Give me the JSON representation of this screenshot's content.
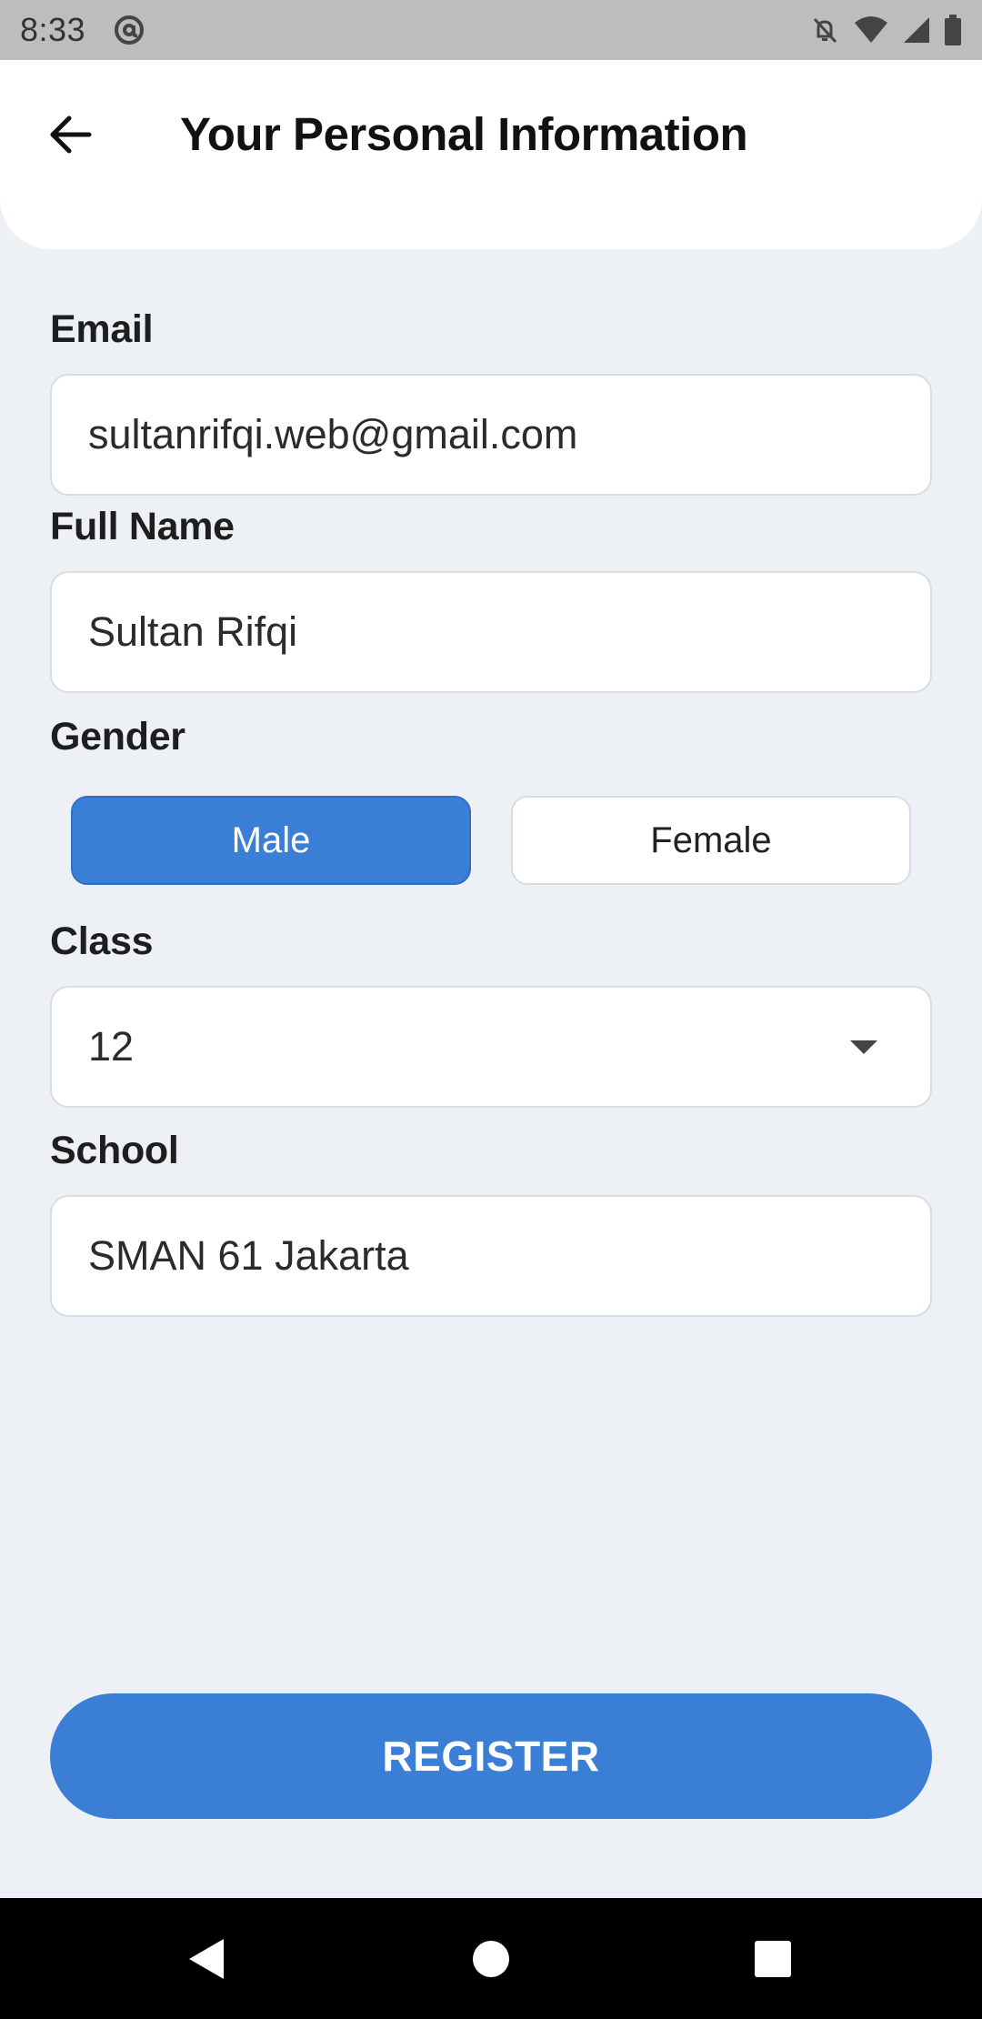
{
  "status_bar": {
    "time": "8:33",
    "icons": [
      "at-sign-icon",
      "notifications-off-icon",
      "wifi-icon",
      "signal-icon",
      "battery-icon"
    ]
  },
  "header": {
    "title": "Your Personal Information",
    "back_icon": "arrow-left-icon"
  },
  "form": {
    "email": {
      "label": "Email",
      "value": "sultanrifqi.web@gmail.com"
    },
    "full_name": {
      "label": "Full Name",
      "value": "Sultan Rifqi"
    },
    "gender": {
      "label": "Gender",
      "options": [
        "Male",
        "Female"
      ],
      "selected": "Male"
    },
    "class": {
      "label": "Class",
      "value": "12",
      "icon": "dropdown-arrow-icon"
    },
    "school": {
      "label": "School",
      "value": "SMAN 61 Jakarta"
    }
  },
  "register_button": {
    "label": "REGISTER"
  },
  "nav_bar": {
    "icons": [
      "back-triangle-icon",
      "home-circle-icon",
      "recents-square-icon"
    ]
  },
  "colors": {
    "accent": "#3B7ED6",
    "background": "#EDF0F4",
    "surface": "#FFFFFF",
    "status_bar": "#BDBDBD",
    "nav_bar": "#000000"
  }
}
